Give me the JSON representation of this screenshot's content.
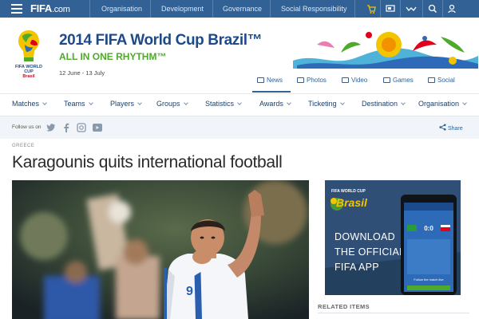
{
  "topbar": {
    "logo": "FIFA",
    "logo_suffix": ".com",
    "nav": [
      "Organisation",
      "Development",
      "Governance",
      "Social Responsibility"
    ],
    "icons": [
      "cart-icon",
      "tv-icon",
      "handshake-icon",
      "search-icon",
      "user-icon"
    ]
  },
  "brand": {
    "wc_label_line1": "FIFA WORLD CUP",
    "wc_label_line2": "Brasil",
    "title": "2014 FIFA World Cup Brazil™",
    "subtitle": "ALL IN ONE RHYTHM™",
    "dates": "12 June - 13 July",
    "tabs": [
      "News",
      "Photos",
      "Video",
      "Games",
      "Social"
    ],
    "active_tab": "News"
  },
  "mainnav": [
    "Matches",
    "Teams",
    "Players",
    "Groups",
    "Statistics",
    "Awards",
    "Ticketing",
    "Destination",
    "Organisation"
  ],
  "followbar": {
    "label": "Follow us on",
    "networks": [
      "twitter-icon",
      "facebook-icon",
      "instagram-icon",
      "youtube-icon"
    ],
    "share_label": "Share"
  },
  "article": {
    "category": "GREECE",
    "headline": "Karagounis quits international football",
    "shirt_number": "9"
  },
  "ad": {
    "logo_text": "FIFA WORLD CUP",
    "brand_word": "Brasil",
    "line1": "DOWNLOAD",
    "line2": "THE OFFICIAL",
    "line3": "FIFA APP",
    "score": "0:0",
    "phone_caption": "Follow the match live"
  },
  "sidebar": {
    "related_label": "RELATED ITEMS"
  },
  "colors": {
    "topbar": "#326295",
    "brand_blue": "#1d4a8a",
    "brand_green": "#4faa2c",
    "accent_red": "#e2001a",
    "follow_bg": "#f1f4f8"
  }
}
